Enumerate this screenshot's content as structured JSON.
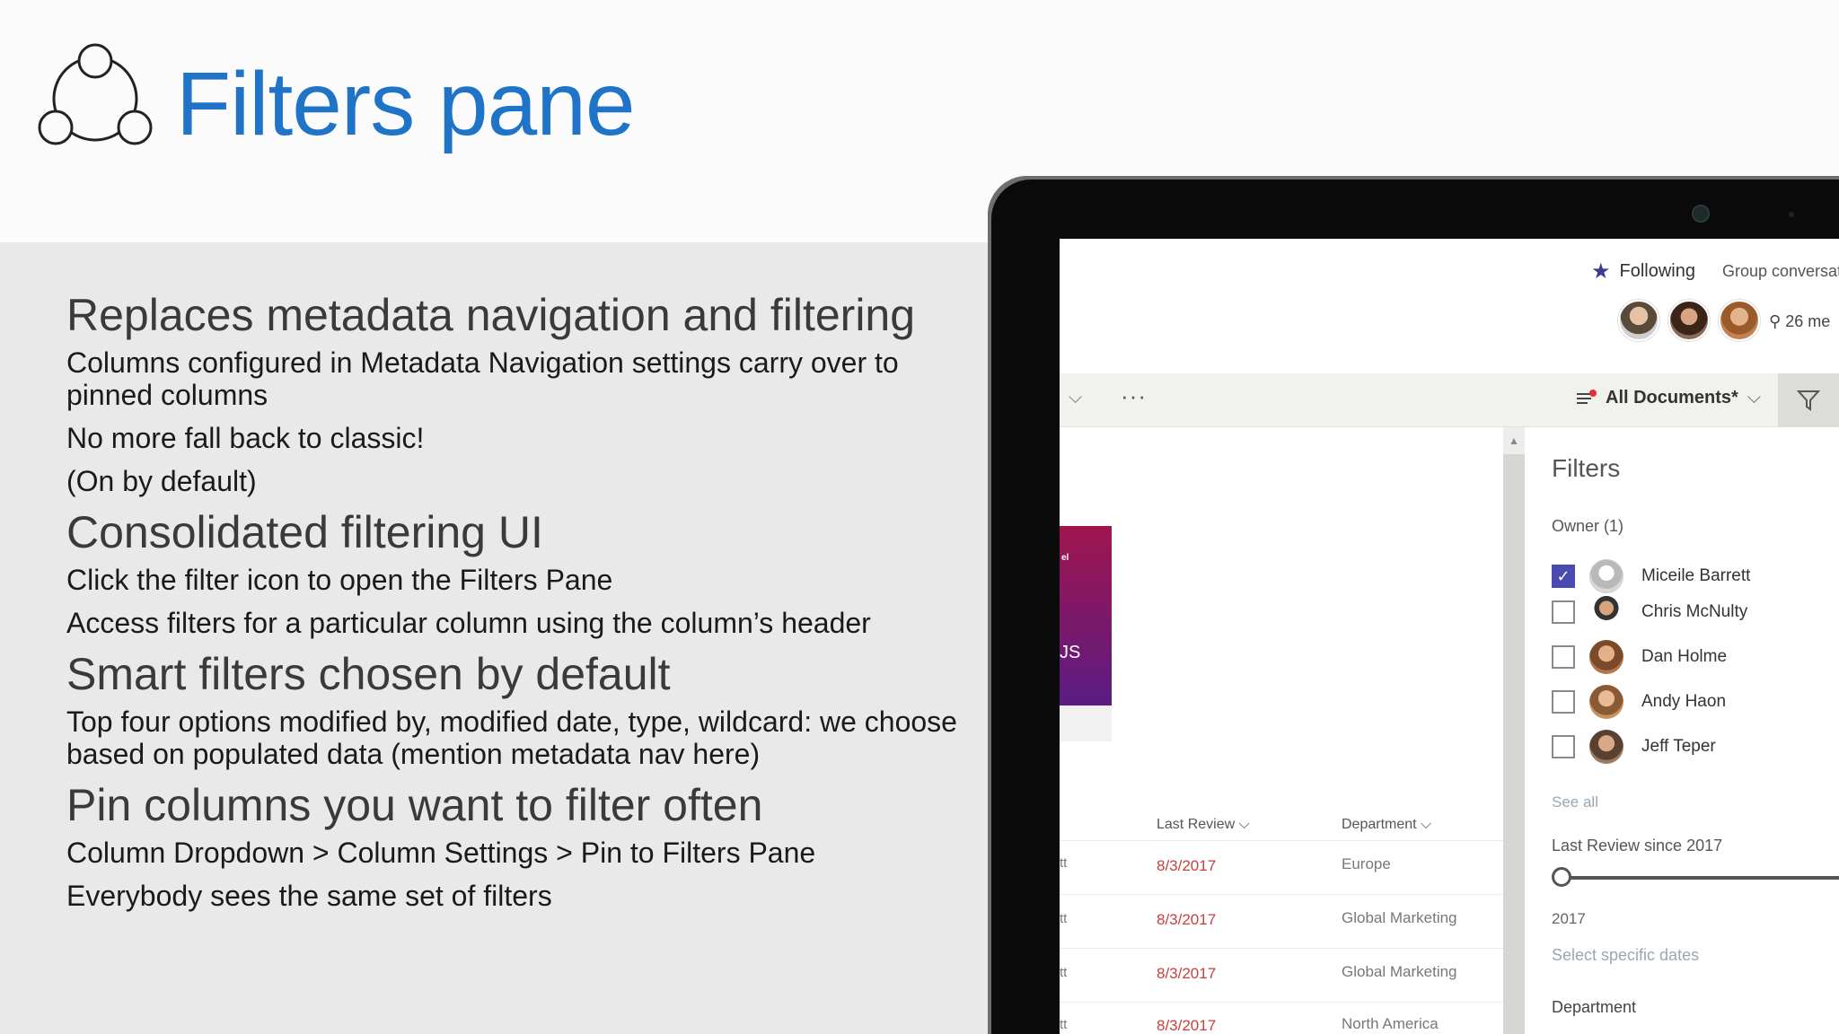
{
  "slide": {
    "title": "Filters pane",
    "sections": [
      {
        "heading": "Replaces metadata navigation and filtering",
        "items": [
          "Columns configured in Metadata Navigation settings carry over to pinned columns",
          "No more fall back to classic!",
          "(On by default)"
        ]
      },
      {
        "heading": "Consolidated filtering UI",
        "items": [
          "Click the filter icon to open the Filters Pane",
          "Access filters for a particular column using the column’s header"
        ]
      },
      {
        "heading": "Smart filters chosen by default",
        "items": [
          "Top four options modified by, modified date, type, wildcard: we choose based on populated data (mention metadata nav here)"
        ]
      },
      {
        "heading": "Pin columns you want to filter often",
        "items": [
          "Column Dropdown > Column Settings > Pin to Filters Pane",
          "Everybody sees the same set of filters"
        ]
      }
    ]
  },
  "screen": {
    "following": "Following",
    "group_conversations": "Group conversat",
    "members": "26 me",
    "view_name": "All Documents*",
    "card_line1": "el",
    "card_line2": "JS",
    "columns": {
      "last_review": "Last Review",
      "department": "Department"
    },
    "rows": [
      {
        "lead": "tt",
        "date": "8/3/2017",
        "dept": "Europe"
      },
      {
        "lead": "tt",
        "date": "8/3/2017",
        "dept": "Global Marketing"
      },
      {
        "lead": "tt",
        "date": "8/3/2017",
        "dept": "Global Marketing"
      },
      {
        "lead": "tt",
        "date": "8/3/2017",
        "dept": "North America"
      }
    ],
    "filters": {
      "title": "Filters",
      "owner_label": "Owner (1)",
      "owners": [
        {
          "name": "Miceile Barrett",
          "checked": true
        },
        {
          "name": "Chris McNulty",
          "checked": false
        },
        {
          "name": "Dan Holme",
          "checked": false
        },
        {
          "name": "Andy Haon",
          "checked": false
        },
        {
          "name": "Jeff Teper",
          "checked": false
        }
      ],
      "see_all": "See all",
      "last_review_label": "Last Review since 2017",
      "slider_year": "2017",
      "select_dates": "Select specific dates",
      "department_label": "Department"
    }
  },
  "colors": {
    "title_blue": "#1f74c8",
    "checkbox_purple": "#4a4ab0",
    "date_red": "#c8403e"
  }
}
